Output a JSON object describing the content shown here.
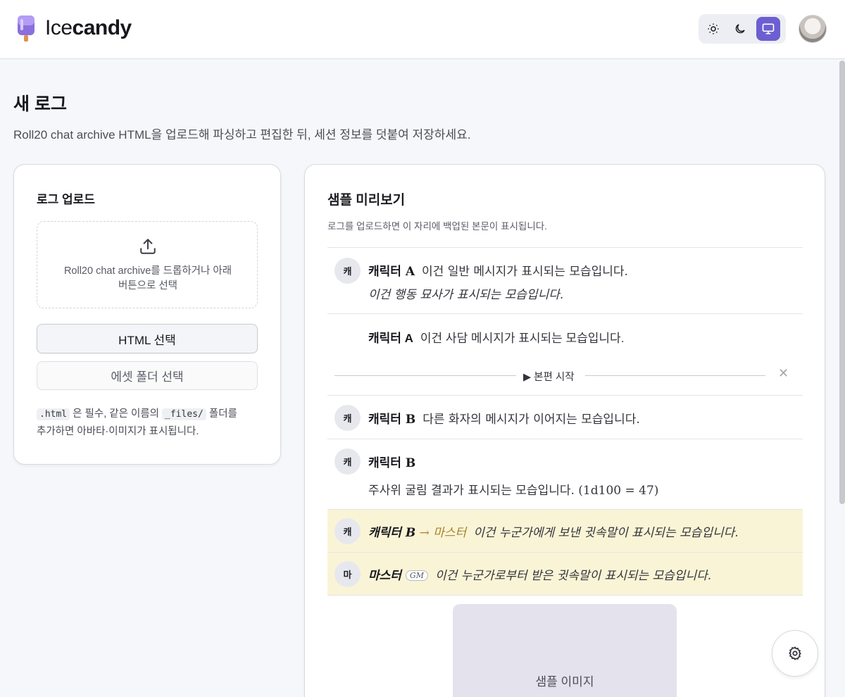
{
  "header": {
    "logo_thin": "Ice",
    "logo_bold": "candy",
    "theme_options": [
      "sun-icon",
      "moon-icon",
      "monitor-icon"
    ],
    "active_theme": "monitor-icon",
    "accent_color": "#6c5fd1"
  },
  "page": {
    "title": "새 로그",
    "description": "Roll20 chat archive HTML을 업로드해 파싱하고 편집한 뒤, 세션 정보를 덧붙여 저장하세요."
  },
  "upload": {
    "title": "로그 업로드",
    "drop_line1": "Roll20 chat archive를 드롭하거나 아래",
    "drop_line2": "버튼으로 선택",
    "html_button": "HTML 선택",
    "asset_button": "에셋 폴더 선택",
    "note_code1": ".html",
    "note_text1": " 은 필수, 같은 이름의 ",
    "note_code2": "_files/",
    "note_text2": " 폴더를",
    "note_text3": "추가하면 아바타·이미지가 표시됩니다."
  },
  "preview": {
    "title": "샘플 미리보기",
    "description": "로그를 업로드하면 이 자리에 백업된 본문이 표시됩니다.",
    "messages": [
      {
        "avatar": "캐",
        "name": "캐릭터 A",
        "text": "이건 일반 메시지가 표시되는 모습입니다.",
        "action": "이건 행동 묘사가 표시되는 모습입니다."
      },
      {
        "name": "캐릭터 A",
        "text": "이건 사담 메시지가 표시되는 모습입니다."
      },
      {
        "divider": "▶ 본편 시작",
        "close": "✕"
      },
      {
        "avatar": "캐",
        "name": "캐릭터 B",
        "text": "다른 화자의 메시지가 이어지는 모습입니다."
      },
      {
        "avatar": "캐",
        "name": "캐릭터 B",
        "text": "주사위 굴림 결과가 표시되는 모습입니다. (1d100 = 47)"
      },
      {
        "avatar": "캐",
        "name": "캐릭터 B",
        "arrow": "→",
        "target": "마스터",
        "text": "이건 누군가에게 보낸 귓속말이 표시되는 모습입니다."
      },
      {
        "avatar": "마",
        "name": "마스터",
        "badge": "GM",
        "text": "이건 누군가로부터 받은 귓속말이 표시되는 모습입니다."
      }
    ],
    "sample_image_label": "샘플 이미지",
    "whisper_bg": "#faf4d6"
  },
  "fab": {
    "icon": "gear-icon"
  }
}
